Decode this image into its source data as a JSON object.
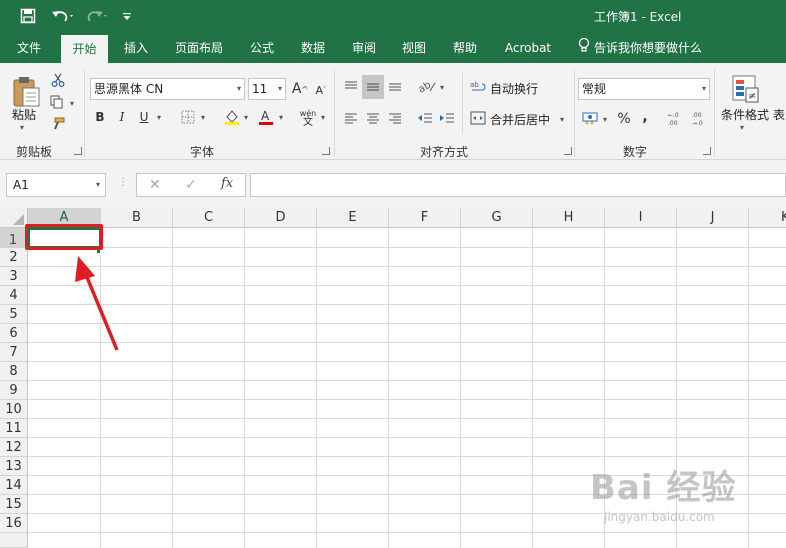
{
  "titlebar": {
    "title": "工作簿1  -  Excel",
    "icons": [
      "save-icon",
      "undo-icon",
      "redo-icon",
      "customize-qat-icon"
    ]
  },
  "tabs": [
    {
      "label": "文件",
      "active": false
    },
    {
      "label": "开始",
      "active": true
    },
    {
      "label": "插入",
      "active": false
    },
    {
      "label": "页面布局",
      "active": false
    },
    {
      "label": "公式",
      "active": false
    },
    {
      "label": "数据",
      "active": false
    },
    {
      "label": "审阅",
      "active": false
    },
    {
      "label": "视图",
      "active": false
    },
    {
      "label": "帮助",
      "active": false
    },
    {
      "label": "Acrobat",
      "active": false
    }
  ],
  "tell_me": "告诉我你想要做什么",
  "ribbon": {
    "clipboard": {
      "paste_label": "粘贴",
      "group_label": "剪贴板"
    },
    "font": {
      "font_name": "思源黑体 CN",
      "font_size": "11",
      "bold": "B",
      "italic": "I",
      "underline": "U",
      "phonetic": "wén",
      "group_label": "字体"
    },
    "alignment": {
      "wrap_text": "自动换行",
      "merge_center": "合并后居中",
      "group_label": "对齐方式"
    },
    "number": {
      "format": "常规",
      "percent": "%",
      "comma": ",",
      "group_label": "数字"
    },
    "styles": {
      "conditional_format": "条件格式",
      "table_partial": "表"
    }
  },
  "formula_bar": {
    "name_box": "A1",
    "fx": "fx",
    "formula": ""
  },
  "grid": {
    "columns": [
      "A",
      "B",
      "C",
      "D",
      "E",
      "F",
      "G",
      "H",
      "I",
      "J",
      "K"
    ],
    "rows": [
      "1",
      "2",
      "3",
      "4",
      "5",
      "6",
      "7",
      "8",
      "9",
      "10",
      "11",
      "12",
      "13",
      "14",
      "15",
      "16"
    ],
    "active_cell": "A1"
  },
  "annotation": {
    "highlight_color": "#e11b22",
    "arrow_color": "#e11b22"
  },
  "watermark": {
    "main": "Bai 经验",
    "sub": "jingyan.baidu.com"
  },
  "colors": {
    "excel_green": "#217346",
    "ribbon_bg": "#f3f3f3"
  }
}
